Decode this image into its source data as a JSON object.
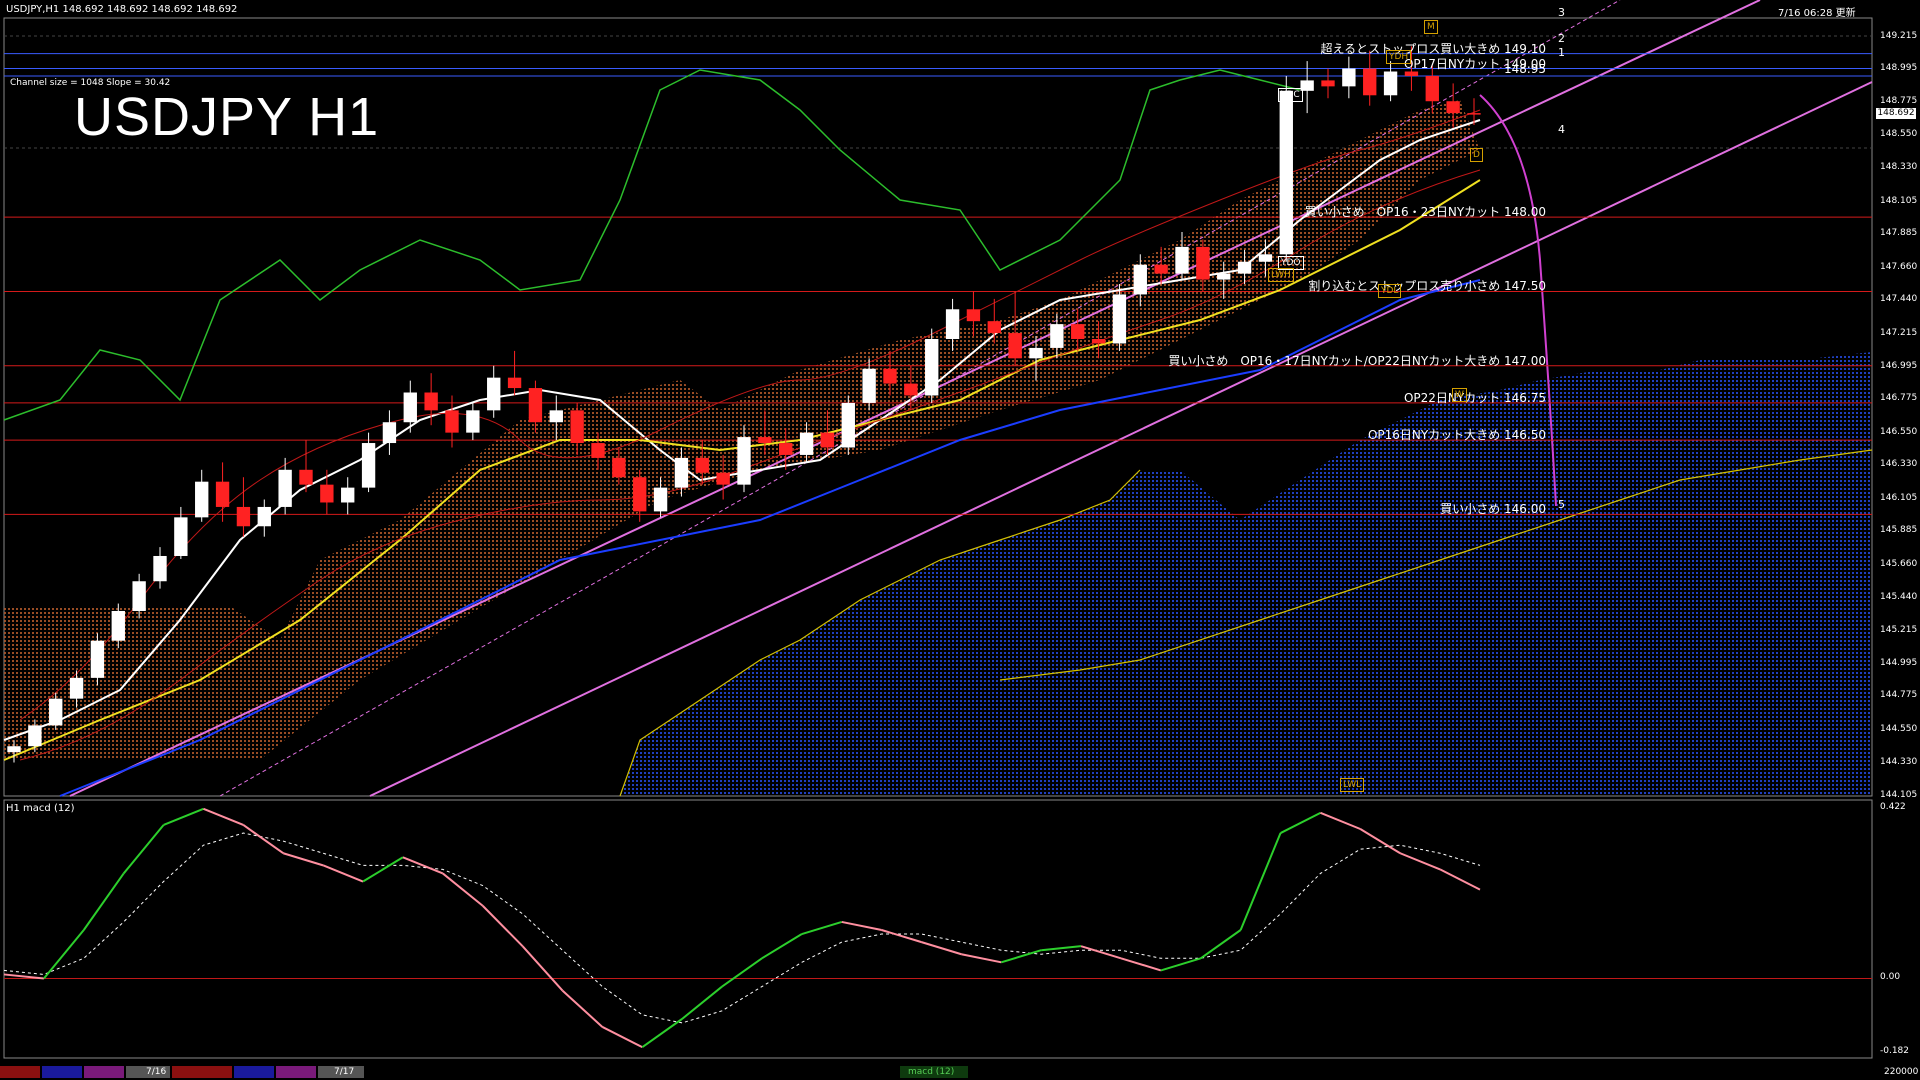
{
  "header": {
    "symbol_info": "USDJPY,H1  148.692 148.692 148.692 148.692",
    "updated": "7/16 06:28 更新",
    "channel_info": "Channel size = 1048 Slope = 30.42",
    "title": "USDJPY H1",
    "macd_label": "H1  macd (12)"
  },
  "chart_data": [
    {
      "type": "candlestick",
      "title": "USDJPY H1",
      "ylim": [
        144.105,
        149.34
      ],
      "y_ticks": [
        "149.215",
        "148.995",
        "148.775",
        "148.550",
        "148.330",
        "148.105",
        "147.885",
        "147.660",
        "147.440",
        "147.215",
        "146.995",
        "146.775",
        "146.550",
        "146.330",
        "146.105",
        "145.885",
        "145.660",
        "145.440",
        "145.215",
        "144.995",
        "144.775",
        "144.550",
        "144.330",
        "144.105"
      ],
      "current_price": "148.692",
      "levels": [
        {
          "price": 149.1,
          "label": "超えるとストップロス買い大きめ 149.10",
          "color": "#3a5cff"
        },
        {
          "price": 149.0,
          "label": "OP17日NYカット 149.00",
          "color": "#3a5cff"
        },
        {
          "price": 148.95,
          "label": "148.95",
          "color": "#3a5cff"
        },
        {
          "price": 148.0,
          "label": "買い小さめ　OP16・23日NYカット 148.00",
          "color": "#d41a1a"
        },
        {
          "price": 147.5,
          "label": "割り込むとストップロス売り小さめ 147.50",
          "color": "#d41a1a"
        },
        {
          "price": 147.0,
          "label": "買い小さめ　OP16・17日NYカット/OP22日NYカット大きめ 147.00",
          "color": "#d41a1a"
        },
        {
          "price": 146.75,
          "label": "OP22日NYカット 146.75",
          "color": "#d41a1a"
        },
        {
          "price": 146.5,
          "label": "OP16日NYカット大きめ 146.50",
          "color": "#d41a1a"
        },
        {
          "price": 146.0,
          "label": "買い小さめ 146.00",
          "color": "#d41a1a"
        }
      ],
      "markers": [
        "YDC",
        "YDO",
        "YDH",
        "LWH",
        "YDL",
        "LWL",
        "W",
        "D",
        "M"
      ],
      "projection_numbers": [
        "1",
        "2",
        "3",
        "4",
        "5"
      ],
      "candles": [
        [
          144.4,
          144.48,
          144.33,
          144.44
        ],
        [
          144.44,
          144.62,
          144.4,
          144.58
        ],
        [
          144.58,
          144.8,
          144.55,
          144.76
        ],
        [
          144.76,
          144.95,
          144.7,
          144.9
        ],
        [
          144.9,
          145.2,
          144.85,
          145.15
        ],
        [
          145.15,
          145.4,
          145.1,
          145.35
        ],
        [
          145.35,
          145.6,
          145.3,
          145.55
        ],
        [
          145.55,
          145.78,
          145.5,
          145.72
        ],
        [
          145.72,
          146.05,
          145.7,
          145.98
        ],
        [
          145.98,
          146.3,
          145.95,
          146.22
        ],
        [
          146.22,
          146.35,
          145.95,
          146.05
        ],
        [
          146.05,
          146.25,
          145.85,
          145.92
        ],
        [
          145.92,
          146.1,
          145.85,
          146.05
        ],
        [
          146.05,
          146.38,
          146.0,
          146.3
        ],
        [
          146.3,
          146.5,
          146.15,
          146.2
        ],
        [
          146.2,
          146.3,
          146.0,
          146.08
        ],
        [
          146.08,
          146.25,
          146.0,
          146.18
        ],
        [
          146.18,
          146.55,
          146.15,
          146.48
        ],
        [
          146.48,
          146.7,
          146.4,
          146.62
        ],
        [
          146.62,
          146.9,
          146.55,
          146.82
        ],
        [
          146.82,
          146.95,
          146.6,
          146.7
        ],
        [
          146.7,
          146.8,
          146.45,
          146.55
        ],
        [
          146.55,
          146.75,
          146.5,
          146.7
        ],
        [
          146.7,
          147.0,
          146.65,
          146.92
        ],
        [
          146.92,
          147.1,
          146.8,
          146.85
        ],
        [
          146.85,
          146.9,
          146.55,
          146.62
        ],
        [
          146.62,
          146.8,
          146.5,
          146.7
        ],
        [
          146.7,
          146.75,
          146.4,
          146.48
        ],
        [
          146.48,
          146.55,
          146.3,
          146.38
        ],
        [
          146.38,
          146.45,
          146.2,
          146.25
        ],
        [
          146.25,
          146.3,
          145.95,
          146.02
        ],
        [
          146.02,
          146.25,
          145.98,
          146.18
        ],
        [
          146.18,
          146.45,
          146.12,
          146.38
        ],
        [
          146.38,
          146.5,
          146.2,
          146.28
        ],
        [
          146.28,
          146.4,
          146.1,
          146.2
        ],
        [
          146.2,
          146.6,
          146.15,
          146.52
        ],
        [
          146.52,
          146.7,
          146.4,
          146.48
        ],
        [
          146.48,
          146.58,
          146.3,
          146.4
        ],
        [
          146.4,
          146.62,
          146.35,
          146.55
        ],
        [
          146.55,
          146.7,
          146.4,
          146.45
        ],
        [
          146.45,
          146.8,
          146.4,
          146.75
        ],
        [
          146.75,
          147.05,
          146.7,
          146.98
        ],
        [
          146.98,
          147.1,
          146.8,
          146.88
        ],
        [
          146.88,
          147.0,
          146.7,
          146.8
        ],
        [
          146.8,
          147.25,
          146.75,
          147.18
        ],
        [
          147.18,
          147.45,
          147.1,
          147.38
        ],
        [
          147.38,
          147.5,
          147.2,
          147.3
        ],
        [
          147.3,
          147.45,
          147.15,
          147.22
        ],
        [
          147.22,
          147.5,
          147.0,
          147.05
        ],
        [
          147.05,
          147.2,
          146.9,
          147.12
        ],
        [
          147.12,
          147.35,
          147.05,
          147.28
        ],
        [
          147.28,
          147.38,
          147.1,
          147.18
        ],
        [
          147.18,
          147.3,
          147.05,
          147.15
        ],
        [
          147.15,
          147.55,
          147.1,
          147.48
        ],
        [
          147.48,
          147.75,
          147.4,
          147.68
        ],
        [
          147.68,
          147.8,
          147.55,
          147.62
        ],
        [
          147.62,
          147.9,
          147.58,
          147.8
        ],
        [
          147.8,
          147.85,
          147.5,
          147.58
        ],
        [
          147.58,
          147.7,
          147.45,
          147.62
        ],
        [
          147.62,
          147.78,
          147.55,
          147.7
        ],
        [
          147.7,
          147.85,
          147.6,
          147.75
        ],
        [
          147.75,
          148.95,
          147.7,
          148.85
        ],
        [
          148.85,
          149.05,
          148.7,
          148.92
        ],
        [
          148.92,
          149.0,
          148.8,
          148.88
        ],
        [
          148.88,
          149.08,
          148.8,
          149.0
        ],
        [
          149.0,
          149.12,
          148.75,
          148.82
        ],
        [
          148.82,
          149.05,
          148.78,
          148.98
        ],
        [
          148.98,
          149.15,
          148.85,
          148.95
        ],
        [
          148.95,
          149.02,
          148.7,
          148.78
        ],
        [
          148.78,
          148.9,
          148.6,
          148.7
        ],
        [
          148.7,
          148.8,
          148.62,
          148.69
        ]
      ]
    },
    {
      "type": "line",
      "title": "macd (12)",
      "ylim": [
        -0.182,
        0.422
      ],
      "y_ticks": [
        "0.422",
        "0.00",
        "-0.182"
      ],
      "series": [
        {
          "name": "",
          "values": [
            0.01,
            0.0,
            0.12,
            0.26,
            0.38,
            0.42,
            0.38,
            0.31,
            0.28,
            0.24,
            0.3,
            0.26,
            0.18,
            0.08,
            -0.03,
            -0.12,
            -0.17,
            -0.1,
            -0.02,
            0.05,
            0.11,
            0.14,
            0.12,
            0.09,
            0.06,
            0.04,
            0.07,
            0.08,
            0.05,
            0.02,
            0.05,
            0.12,
            0.36,
            0.41,
            0.37,
            0.31,
            0.27,
            0.22
          ]
        },
        {
          "name": "",
          "values": [
            0.02,
            0.01,
            0.05,
            0.14,
            0.24,
            0.33,
            0.36,
            0.34,
            0.31,
            0.28,
            0.28,
            0.27,
            0.23,
            0.16,
            0.07,
            -0.02,
            -0.09,
            -0.11,
            -0.08,
            -0.02,
            0.04,
            0.09,
            0.11,
            0.11,
            0.09,
            0.07,
            0.06,
            0.07,
            0.07,
            0.05,
            0.05,
            0.07,
            0.16,
            0.26,
            0.32,
            0.33,
            0.31,
            0.28
          ]
        }
      ]
    }
  ],
  "bottom_bar": {
    "date_1": "7/16",
    "date_2": "7/17",
    "button": "macd (12)",
    "right_value": "220000"
  }
}
